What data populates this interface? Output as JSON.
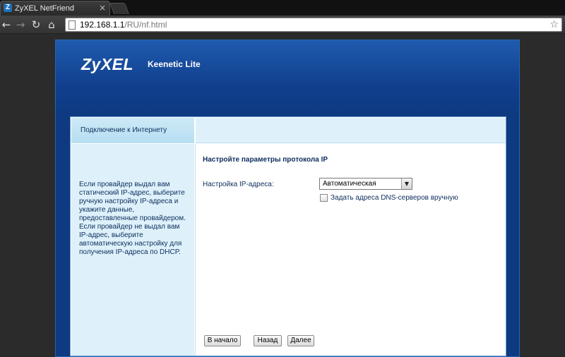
{
  "browser": {
    "tab_icon": "Z",
    "tab_title": "ZyXEL NetFriend",
    "tab_close": "×",
    "url_host": "192.168.1.1",
    "url_path": "/RU/nf.html",
    "icons": [
      "back-arrow-icon",
      "forward-arrow-icon",
      "reload-icon",
      "home-icon",
      "page-icon",
      "star-icon"
    ]
  },
  "header": {
    "logo": "ZyXEL",
    "model": "Keenetic Lite"
  },
  "panel": {
    "section_tab": "Подключение к Интернету",
    "help_text": "Если провайдер выдал вам статический IP-адрес, выберите ручную настройку IP-адреса и укажите данные, предоставленные провайдером. Если провайдер не выдал вам IP-адрес, выберите автоматическую настройку для получения IP-адреса по DHCP.",
    "section_title": "Настройте параметры протокола IP",
    "ip_label": "Настройка IP-адреса:",
    "ip_mode_selected": "Автоматическая",
    "dns_manual_label": "Задать адреса DNS-серверов вручную",
    "dns_manual_checked": false
  },
  "buttons": {
    "home": "В начало",
    "back": "Назад",
    "next": "Далее"
  },
  "colors": {
    "header_blue": "#0d3a80",
    "sidebar_bg": "#def1fa",
    "text_navy": "#0c2d5c"
  }
}
